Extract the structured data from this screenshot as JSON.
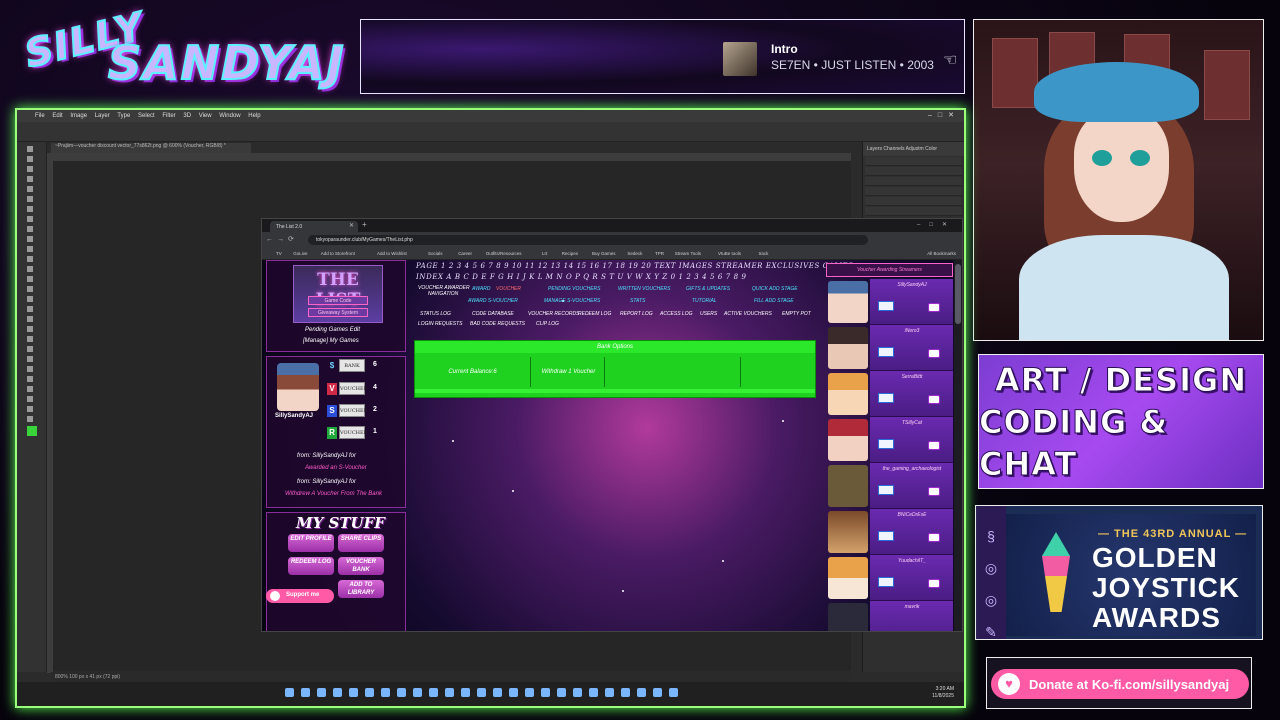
{
  "overlay": {
    "logo_line1": "SILLY",
    "logo_line2": "SANDYAJ",
    "now_playing": {
      "title": "Intro",
      "subtitle": "SE7EN • JUST LISTEN • 2003"
    },
    "art_panel": {
      "line1": "ART / DESIGN",
      "line2": "CODING & CHAT"
    },
    "gj_panel": {
      "subtitle": "— THE 43RD ANNUAL —",
      "line1": "GOLDEN",
      "line2": "JOYSTICK",
      "line3": "AWARDS"
    },
    "kofi": {
      "text": "Donate at Ko-fi.com/sillysandyaj"
    }
  },
  "photoshop": {
    "menu": [
      "File",
      "Edit",
      "Image",
      "Layer",
      "Type",
      "Select",
      "Filter",
      "3D",
      "View",
      "Window",
      "Help"
    ],
    "doc_tab": "~Prajiim—voucher discount vector_77s862t.png @ 600% (Voucher, RGB/8) *",
    "panel_tabs": "Layers  Channels  Adjustm  Color",
    "status": "800%   100 px x 41 px (72 ppi)",
    "clock_time": "3:20 AM",
    "clock_date": "11/8/2025"
  },
  "browser": {
    "tab_title": "The List 2.0",
    "url": "tokyoparaunder.club/MyGames/TheList.php",
    "bookmarks": [
      "TV",
      "GoLive",
      "Add to Storefront",
      "Add to Wishlist",
      "Socials",
      "Career",
      "Outfits/Resources",
      "Lrt",
      "Recipes",
      "Buy Games",
      "Sedeck",
      "TPR",
      "Stream Tools",
      "VtuBe tools",
      "track",
      "All Bookmarks"
    ]
  },
  "page": {
    "the_list": {
      "title": "THE LIST",
      "sub1": "Game Code",
      "sub2": "Giveaway System"
    },
    "pending_link": "Pending Games Edit",
    "manage_link": "[Manage] My Games",
    "username": "SillySandyAJ",
    "bank": [
      {
        "icon": "$",
        "label": "BANK",
        "count": "6"
      },
      {
        "icon": "V",
        "label": "VOUCHER",
        "count": "4"
      },
      {
        "icon": "S",
        "label": "VOUCHER",
        "count": "2"
      },
      {
        "icon": "R",
        "label": "VOUCHER",
        "count": "1"
      }
    ],
    "activity": [
      {
        "from": "from: SillySandyAJ for",
        "desc": "Awarded an S-Voucher"
      },
      {
        "from": "from: SillySandyAJ for",
        "desc": "Withdrew A Voucher From The Bank"
      }
    ],
    "my_stuff": {
      "title": "MY STUFF",
      "buttons": [
        "EDIT PROFILE",
        "SHARE CLIPS",
        "REDEEM LOG",
        "VOUCHER BANK",
        "ADD TO LIBRARY"
      ]
    },
    "support_label": "Support me",
    "index_page": "PAGE  1 2 3 4 5 6 7 8 9 10 11 12 13 14 15 16 17 18 19 20   TEXT  IMAGES  STREAMER EXCLUSIVES  GAMES",
    "index_alpha": "INDEX  A B C D E F G H I J K L M N O P Q R S T U V W X Y Z 0 1 2 3 4 5 6 7 8 9",
    "nav": {
      "voucher_awarder": "VOUCHER AWARDER",
      "navigation": "NAVIGATION",
      "award": "AWARD",
      "voucher": "VOUCHER",
      "pending_vouchers": "PENDING VOUCHERS",
      "written_vouchers": "WRITTEN VOUCHERS",
      "gifts": "GIFTS & UPDATES",
      "quick_add": "QUICK ADD STAGE",
      "award_svoucher": "AWARD S-VOUCHER",
      "manage_svouchers": "MANAGE S-VOUCHERS",
      "stats": "STATS",
      "tutorial": "TUTORIAL",
      "fill_stage": "FILL ADD STAGE",
      "row3": [
        "STATUS LOG",
        "CODE DATABASE",
        "VOUCHER RECORDS",
        "REDEEM LOG",
        "REPORT LOG",
        "ACCESS LOG",
        "USERS",
        "ACTIVE VOUCHERS",
        "EMPTY POT"
      ],
      "row4": [
        "LOGIN REQUESTS",
        "BAD CODE REQUESTS",
        "CLIP LOG"
      ]
    },
    "bank_options": {
      "heading": "Bank Options",
      "cells": [
        "Current Balance:6",
        "Withdraw 1 Voucher",
        "",
        ""
      ]
    },
    "recent_heading": "Voucher Awarding Streamers",
    "members": [
      "SillySandyAJ",
      "iNero3",
      "SerraBittt",
      "TSillyCat",
      "the_gaming_archaeologist",
      "BNiCeDrEsE",
      "YuudachiIT_",
      "mavrik"
    ]
  },
  "colors": {
    "accent_green": "#1fd21f",
    "accent_pink": "#ff5aa5",
    "accent_purple": "#8c2c9b"
  }
}
